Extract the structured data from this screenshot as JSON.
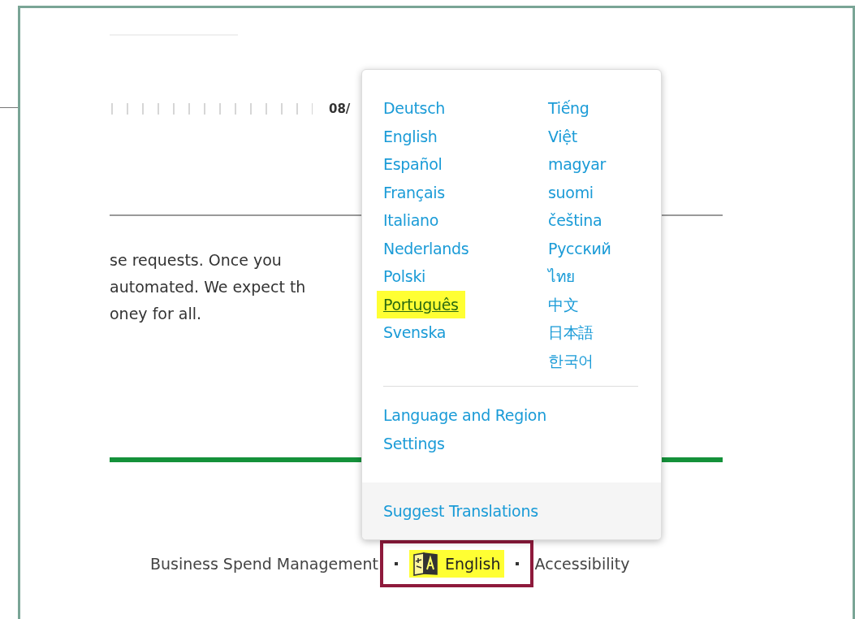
{
  "page": {
    "date_fragment": "08/",
    "paragraph_lines": [
      "se requests. Once you",
      "automated. We expect th",
      "oney for all."
    ]
  },
  "language_menu": {
    "columns": [
      {
        "items": [
          {
            "label": "Deutsch",
            "highlighted": false
          },
          {
            "label": "English",
            "highlighted": false
          },
          {
            "label": "Español",
            "highlighted": false
          },
          {
            "label": "Français",
            "highlighted": false
          },
          {
            "label": "Italiano",
            "highlighted": false
          },
          {
            "label": "Nederlands",
            "highlighted": false
          },
          {
            "label": "Polski",
            "highlighted": false
          },
          {
            "label": "Português",
            "highlighted": true
          },
          {
            "label": "Svenska",
            "highlighted": false
          }
        ]
      },
      {
        "items": [
          {
            "label": "Tiếng Việt",
            "highlighted": false
          },
          {
            "label": "magyar",
            "highlighted": false
          },
          {
            "label": "suomi",
            "highlighted": false
          },
          {
            "label": "čeština",
            "highlighted": false
          },
          {
            "label": "Русский",
            "highlighted": false
          },
          {
            "label": "ไทย",
            "highlighted": false
          },
          {
            "label": "中文",
            "highlighted": false
          },
          {
            "label": "日本語",
            "highlighted": false
          },
          {
            "label": "한국어",
            "highlighted": false
          }
        ]
      }
    ],
    "settings_link": "Language and Region Settings",
    "suggest_link": "Suggest Translations"
  },
  "footer": {
    "left_link": "Business Spend Management",
    "language": {
      "label": "English",
      "highlighted": true,
      "outlined": true
    },
    "right_link": "Accessibility"
  }
}
